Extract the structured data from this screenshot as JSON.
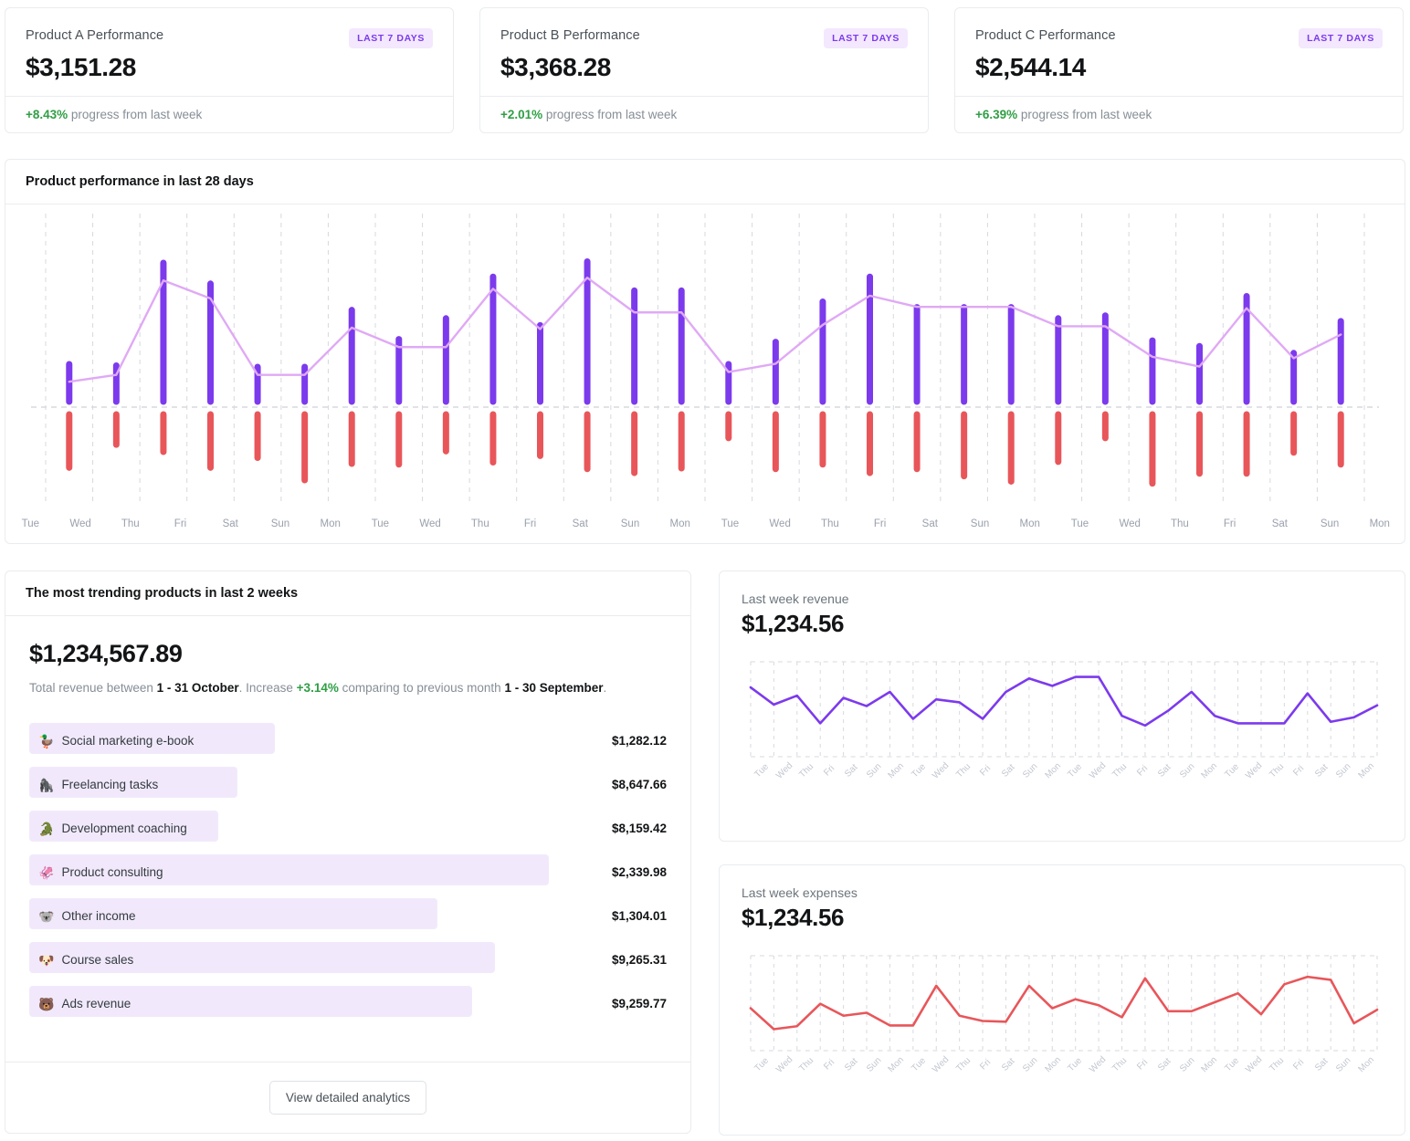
{
  "stats": [
    {
      "title": "Product A Performance",
      "badge": "LAST 7 DAYS",
      "value": "$3,151.28",
      "delta": "+8.43%",
      "delta_text": " progress from last week"
    },
    {
      "title": "Product B Performance",
      "badge": "LAST 7 DAYS",
      "value": "$3,368.28",
      "delta": "+2.01%",
      "delta_text": " progress from last week"
    },
    {
      "title": "Product C Performance",
      "badge": "LAST 7 DAYS",
      "value": "$2,544.14",
      "delta": "+6.39%",
      "delta_text": " progress from last week"
    }
  ],
  "main_chart": {
    "title": "Product performance in last 28 days"
  },
  "trending": {
    "title": "The most trending products in last 2 weeks",
    "total": "$1,234,567.89",
    "desc_1": "Total revenue between ",
    "desc_range_1": "1 - 31 October",
    "desc_2": ". Increase ",
    "desc_pct": "+3.14%",
    "desc_3": " comparing to previous month ",
    "desc_range_2": "1 - 30 September",
    "desc_4": ".",
    "button": "View detailed analytics",
    "products": [
      {
        "emoji": "🦆",
        "icon": "duck-icon",
        "name": "Social marketing e-book",
        "value": "$1,282.12",
        "bar_pct": 38.5
      },
      {
        "emoji": "🦍",
        "icon": "gorilla-icon",
        "name": "Freelancing tasks",
        "value": "$8,647.66",
        "bar_pct": 32.6
      },
      {
        "emoji": "🐊",
        "icon": "crocodile-icon",
        "name": "Development coaching",
        "value": "$8,159.42",
        "bar_pct": 29.6
      },
      {
        "emoji": "🦑",
        "icon": "squid-icon",
        "name": "Product consulting",
        "value": "$2,339.98",
        "bar_pct": 81.5
      },
      {
        "emoji": "🐨",
        "icon": "koala-icon",
        "name": "Other income",
        "value": "$1,304.01",
        "bar_pct": 64.0
      },
      {
        "emoji": "🐶",
        "icon": "dog-icon",
        "name": "Course sales",
        "value": "$9,265.31",
        "bar_pct": 73.0
      },
      {
        "emoji": "🐻",
        "icon": "bear-icon",
        "name": "Ads revenue",
        "value": "$9,259.77",
        "bar_pct": 69.5
      }
    ]
  },
  "revenue_panel": {
    "title": "Last week revenue",
    "value": "$1,234.56"
  },
  "expenses_panel": {
    "title": "Last week expenses",
    "value": "$1,234.56"
  },
  "colors": {
    "purple": "#7c3aed",
    "purple_line": "#e0a9f5",
    "red": "#e8565a",
    "badge_bg": "#f3e8fd",
    "badge_text": "#7c3aed",
    "green": "#2f9e44",
    "bar_track": "#f1e9fb",
    "grid": "#d6d9de"
  },
  "chart_data": [
    {
      "type": "bar",
      "id": "product-performance-28-days",
      "title": "Product performance in last 28 days",
      "xlabel": "",
      "ylabel": "",
      "grid": true,
      "categories": [
        "Tue",
        "Wed",
        "Thu",
        "Fri",
        "Sat",
        "Sun",
        "Mon",
        "Tue",
        "Wed",
        "Thu",
        "Fri",
        "Sat",
        "Sun",
        "Mon",
        "Tue",
        "Wed",
        "Thu",
        "Fri",
        "Sat",
        "Sun",
        "Mon",
        "Tue",
        "Wed",
        "Thu",
        "Fri",
        "Sat",
        "Sun",
        "Mon"
      ],
      "day_labels": [
        "Tue",
        "Wed",
        "Thu",
        "Fri",
        "Sat",
        "Sun",
        "Mon",
        "Tue",
        "Wed",
        "Thu",
        "Fri",
        "Sat",
        "Sun",
        "Mon",
        "Tue",
        "Wed",
        "Thu",
        "Fri",
        "Sat",
        "Sun",
        "Mon",
        "Tue",
        "Wed",
        "Thu",
        "Fri",
        "Sat",
        "Sun",
        "Mon"
      ],
      "series": [
        {
          "name": "positive",
          "color": "#7c3aed",
          "direction": "up",
          "values": [
            27,
            26,
            100,
            85,
            25,
            25,
            66,
            45,
            60,
            90,
            55,
            101,
            80,
            80,
            27,
            43,
            72,
            90,
            68,
            68,
            68,
            60,
            62,
            44,
            40,
            76,
            35,
            58
          ]
        },
        {
          "name": "negative",
          "color": "#e8565a",
          "direction": "down",
          "values": [
            81,
            46,
            57,
            81,
            66,
            100,
            75,
            76,
            56,
            73,
            63,
            83,
            89,
            82,
            36,
            83,
            76,
            89,
            83,
            94,
            102,
            72,
            36,
            105,
            90,
            90,
            58,
            76
          ]
        },
        {
          "name": "trend-line",
          "color": "#e0a9f5",
          "type": "line",
          "values": [
            13,
            18,
            86,
            73,
            18,
            18,
            52,
            38,
            38,
            80,
            51,
            88,
            63,
            63,
            20,
            26,
            54,
            75,
            67,
            67,
            67,
            53,
            53,
            31,
            24,
            66,
            30,
            47
          ]
        }
      ]
    },
    {
      "type": "line",
      "id": "last-week-revenue",
      "title": "Last week revenue",
      "value": "$1,234.56",
      "color": "#7c3aed",
      "grid": true,
      "categories": [
        "Tue",
        "Wed",
        "Thu",
        "Fri",
        "Sat",
        "Sun",
        "Mon",
        "Tue",
        "Wed",
        "Thu",
        "Fri",
        "Sat",
        "Sun",
        "Mon",
        "Tue",
        "Wed",
        "Thu",
        "Fri",
        "Sat",
        "Sun",
        "Mon",
        "Tue",
        "Wed",
        "Thu",
        "Fri",
        "Sat",
        "Sun",
        "Mon"
      ],
      "values": [
        78,
        55,
        67,
        30,
        64,
        53,
        72,
        36,
        62,
        58,
        36,
        72,
        90,
        80,
        92,
        92,
        40,
        27,
        47,
        72,
        40,
        30,
        30,
        30,
        70,
        32,
        38,
        54
      ]
    },
    {
      "type": "line",
      "id": "last-week-expenses",
      "title": "Last week expenses",
      "value": "$1,234.56",
      "color": "#e8565a",
      "grid": true,
      "categories": [
        "Tue",
        "Wed",
        "Thu",
        "Fri",
        "Sat",
        "Sun",
        "Mon",
        "Tue",
        "Wed",
        "Thu",
        "Fri",
        "Sat",
        "Sun",
        "Mon",
        "Tue",
        "Wed",
        "Thu",
        "Fri",
        "Sat",
        "Sun",
        "Mon",
        "Tue",
        "Wed",
        "Thu",
        "Fri",
        "Sat",
        "Sun",
        "Mon"
      ],
      "values": [
        42,
        14,
        18,
        48,
        32,
        36,
        19,
        19,
        72,
        32,
        25,
        24,
        72,
        42,
        54,
        46,
        30,
        82,
        38,
        38,
        50,
        62,
        34,
        74,
        84,
        80,
        22,
        40
      ]
    }
  ]
}
